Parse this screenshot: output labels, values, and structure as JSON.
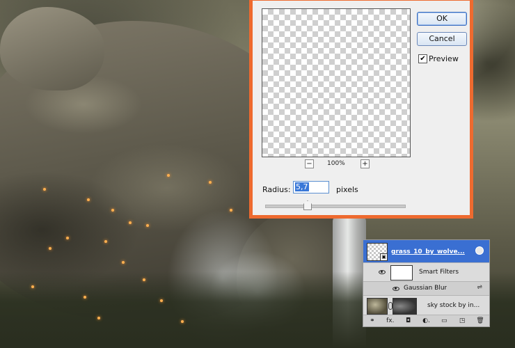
{
  "dialog": {
    "ok_label": "OK",
    "cancel_label": "Cancel",
    "preview_label": "Preview",
    "preview_checked": true,
    "zoom_out_label": "−",
    "zoom_in_label": "+",
    "zoom_level": "100%",
    "radius_label": "Radius:",
    "radius_value": "5,7",
    "radius_unit": "pixels",
    "accent_border_color": "#ee6a2f"
  },
  "layers": {
    "rows": [
      {
        "name": "grass_10_by_wolve...",
        "selected": true
      },
      {
        "name": "Smart Filters"
      },
      {
        "name": "Gaussian Blur"
      },
      {
        "name": "sky stock by in..."
      }
    ],
    "toolbar_icons": [
      "link-icon",
      "fx-icon",
      "mask-icon",
      "adjustment-icon",
      "folder-icon",
      "new-layer-icon",
      "trash-icon"
    ],
    "toolbar_glyphs": [
      "⚭",
      "fx.",
      "◘",
      "◐.",
      "▭",
      "◳",
      "🗑"
    ]
  }
}
